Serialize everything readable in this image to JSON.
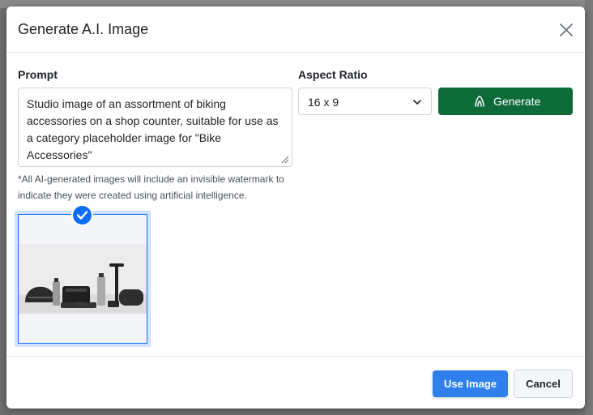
{
  "modal": {
    "title": "Generate A.I. Image"
  },
  "prompt": {
    "label": "Prompt",
    "value": "Studio image of an assortment of biking accessories on a shop counter, suitable for use as a category placeholder image for \"Bike Accessories\"",
    "hint": "*All AI-generated images will include an invisible watermark to indicate they were created using artificial intelligence."
  },
  "aspect_ratio": {
    "label": "Aspect Ratio",
    "selected": "16 x 9"
  },
  "generate": {
    "label": "Generate",
    "icon": "ai-sparkle-icon",
    "color": "#0d6b3a"
  },
  "images": [
    {
      "selected": true,
      "alt_icon": "bike-accessories-thumbnail"
    }
  ],
  "footer": {
    "use_label": "Use Image",
    "cancel_label": "Cancel",
    "accent": "#2f80ed"
  }
}
